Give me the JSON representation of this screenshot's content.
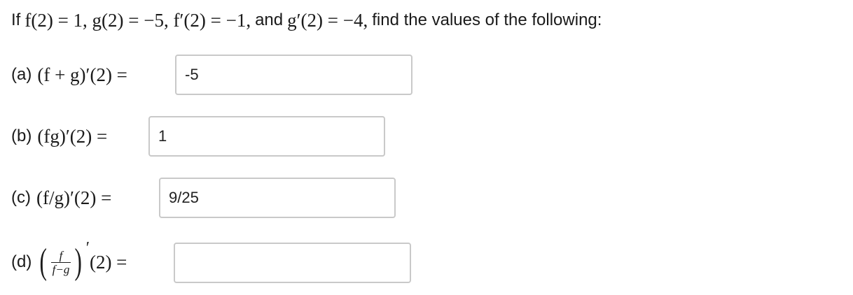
{
  "question": {
    "prefix": "If",
    "given": "f(2) = 1, g(2) = −5, f′(2) = −1,",
    "and_word": "and",
    "given2": "g′(2) = −4,",
    "suffix": "find the values of the following:"
  },
  "parts": [
    {
      "label": "(a)",
      "expr": "(f + g)′(2) =",
      "value": "-5"
    },
    {
      "label": "(b)",
      "expr": "(fg)′(2) =",
      "value": "1"
    },
    {
      "label": "(c)",
      "expr": "(f/g)′(2) =",
      "value": "9/25"
    },
    {
      "label": "(d)",
      "frac_num": "f",
      "frac_den": "f−g",
      "prime": "′",
      "expr_tail": "(2) =",
      "value": ""
    }
  ]
}
